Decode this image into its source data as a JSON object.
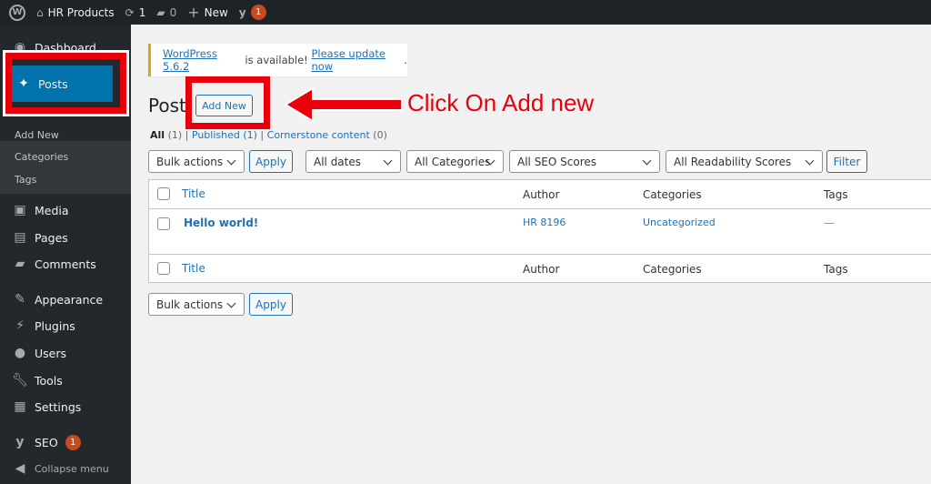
{
  "adminbar": {
    "site": "HR Products",
    "updates": "1",
    "comments": "0",
    "new": "New",
    "yoast_badge": "1"
  },
  "sidebar": {
    "items": [
      {
        "label": "Dashboard",
        "icon": "dashboard-icon"
      },
      {
        "label": "Posts",
        "icon": "pin-icon"
      },
      {
        "label": "Media",
        "icon": "media-icon"
      },
      {
        "label": "Pages",
        "icon": "pages-icon"
      },
      {
        "label": "Comments",
        "icon": "comment-icon"
      },
      {
        "label": "Appearance",
        "icon": "brush-icon"
      },
      {
        "label": "Plugins",
        "icon": "plugin-icon"
      },
      {
        "label": "Users",
        "icon": "user-icon"
      },
      {
        "label": "Tools",
        "icon": "wrench-icon"
      },
      {
        "label": "Settings",
        "icon": "settings-icon"
      },
      {
        "label": "SEO",
        "icon": "yoast-icon",
        "badge": "1"
      },
      {
        "label": "Collapse menu",
        "icon": "collapse-icon"
      }
    ],
    "submenu": [
      "Add New",
      "Categories",
      "Tags"
    ]
  },
  "notice": {
    "link1": "WordPress 5.6.2",
    "text": " is available! ",
    "link2": "Please update now",
    "end": "."
  },
  "page": {
    "title": "Post",
    "add_new": "Add New"
  },
  "views": {
    "all": "All",
    "all_count": "(1)",
    "published": "Published (1)",
    "cornerstone": "Cornerstone content",
    "cornerstone_count": "(0)",
    "sep": "|"
  },
  "filters": {
    "bulk": "Bulk actions",
    "apply": "Apply",
    "dates": "All dates",
    "categories": "All Categories",
    "seo": "All SEO Scores",
    "readability": "All Readability Scores",
    "filter": "Filter"
  },
  "table": {
    "columns": [
      "Title",
      "Author",
      "Categories",
      "Tags"
    ],
    "rows": [
      {
        "title": "Hello world!",
        "author": "HR 8196",
        "categories": "Uncategorized",
        "tags": "—"
      }
    ]
  },
  "annotation": {
    "text": "Click On Add new",
    "color": "#e8000b"
  },
  "colors": {
    "adminbar": "#1d2327",
    "sidebar": "#23282d",
    "active": "#0073aa",
    "link": "#2271b1"
  }
}
